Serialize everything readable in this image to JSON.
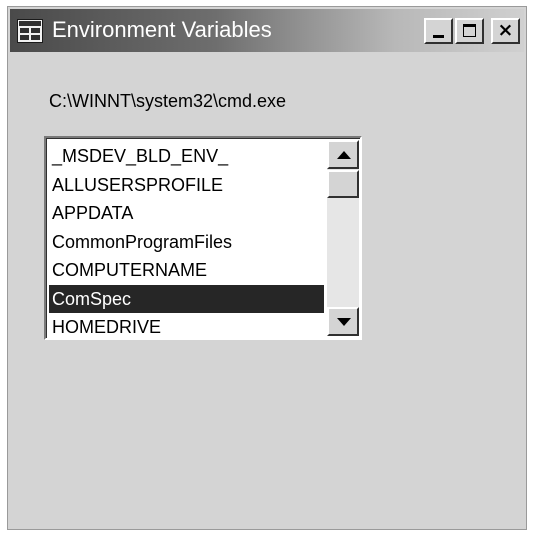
{
  "window": {
    "title": "Environment Variables",
    "close_glyph": "×"
  },
  "path_label": "C:\\WINNT\\system32\\cmd.exe",
  "list": {
    "items": [
      "_MSDEV_BLD_ENV_",
      "ALLUSERSPROFILE",
      "APPDATA",
      "CommonProgramFiles",
      "COMPUTERNAME",
      "ComSpec",
      "HOMEDRIVE"
    ],
    "selected": "ComSpec"
  },
  "colors": {
    "selection_bg": "#262626",
    "window_bg": "#d4d4d4"
  }
}
